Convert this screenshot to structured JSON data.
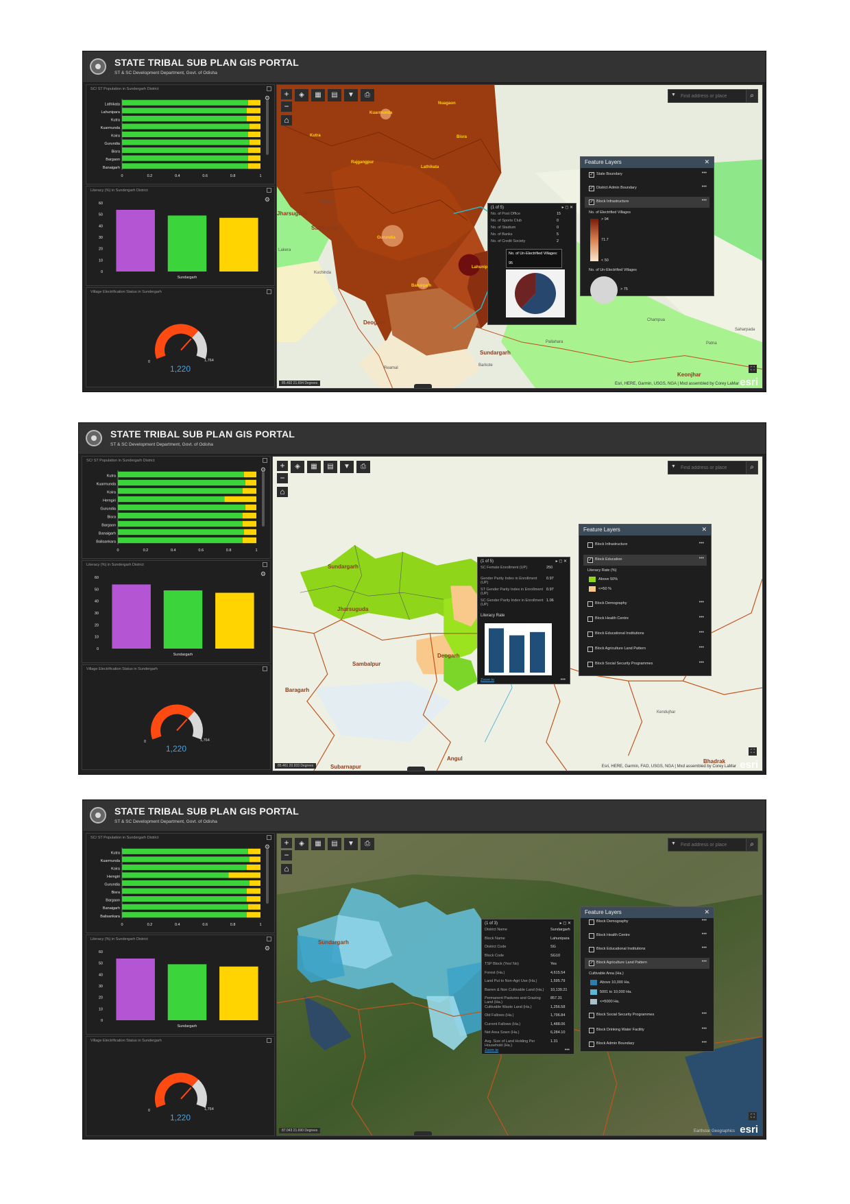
{
  "app": {
    "title": "STATE TRIBAL SUB PLAN GIS PORTAL",
    "subtitle": "ST & SC Development Department, Govt. of Odisha"
  },
  "panel_titles": {
    "population": "SC/ ST Population in Sundergarh District",
    "literacy": "Literacy (%) in Sundergarh District",
    "electrification": "Village Electrification Status in Sundergarh"
  },
  "search_placeholder": "Find address or place",
  "feature_layers_title": "Feature Layers",
  "gauge": {
    "min_label": "0",
    "max_label": "1,764",
    "value_label": "1,220",
    "value": 1220,
    "max": 1764
  },
  "colors": {
    "green": "#3bd43b",
    "yellow": "#ffd400",
    "purple": "#b455d4",
    "gauge": "#ff4a12",
    "map_brown": "#9b3b10"
  },
  "screens": [
    {
      "population": {
        "categories": [
          "Lathikata",
          "Lahunipara",
          "Kutra",
          "Kuarmunda",
          "Koira",
          "Gurundia",
          "Bisra",
          "Bargaon",
          "Banaigarh"
        ],
        "st_share": [
          0.91,
          0.9,
          0.9,
          0.92,
          0.91,
          0.92,
          0.91,
          0.91,
          0.91
        ]
      },
      "coord": "85.492 21.694 Degrees",
      "attribution": "Esri, HERE, Garmin, USGS, NGA | Mxd assembled by Corey LaMar",
      "map_labels": [
        "Kuarmunda",
        "Nuagaon",
        "Kutra",
        "Bisra",
        "Rajgangpur",
        "Lathikata",
        "Gurundia",
        "Banaigarh",
        "Lahunipara",
        "Jharsuguda",
        "Sambalpur",
        "Deogarh",
        "Sundargarh",
        "Keonjhar",
        "Bamra",
        "Kuchinda",
        "Pallahara",
        "Reamal",
        "Barkote",
        "Champua",
        "Saharpada",
        "Patna",
        "Lakera"
      ],
      "layers": [
        {
          "label": "State Boundary",
          "checked": true,
          "selected": false
        },
        {
          "label": "District Admin Boundary",
          "checked": true,
          "selected": false
        },
        {
          "label": "Block Infrastructure",
          "checked": true,
          "selected": true
        }
      ],
      "legend": {
        "electrified_title": "No. of Electrified Villages",
        "high": "> 94",
        "mid": "71.7",
        "low": "< 50",
        "unelectrified_title": "No. of Un-Electrified Villages",
        "bubble": "> 75"
      },
      "popup": {
        "header": "(1 of 5)",
        "rows": [
          {
            "k": "No. of Post Office",
            "v": "15"
          },
          {
            "k": "No. of Sports Club",
            "v": "0"
          },
          {
            "k": "No. of Stadium",
            "v": "0"
          },
          {
            "k": "No. of Banks",
            "v": "5"
          },
          {
            "k": "No. of Credit Society",
            "v": "2"
          }
        ],
        "tooltip_title": "No. of Un-Electrified Villages:",
        "tooltip_value": "95",
        "pie_share": 0.62
      }
    },
    {
      "population": {
        "categories": [
          "Kutra",
          "Kuarmunda",
          "Koira",
          "Hemgiri",
          "Gurundia",
          "Bisra",
          "Bargaon",
          "Banaigarh",
          "Balisankara"
        ],
        "st_share": [
          0.91,
          0.92,
          0.9,
          0.77,
          0.92,
          0.9,
          0.9,
          0.91,
          0.9
        ]
      },
      "coord": "85.461 20.933 Degrees",
      "attribution": "Esri, HERE, Garmin, FAO, USGS, NGA | Mxd assembled by Corey LaMar",
      "map_labels": [
        "Sundargarh",
        "Jharsuguda",
        "Sambalpur",
        "Deogarh",
        "Baragarh",
        "Subarnapur",
        "Angul",
        "Bhadrak",
        "Kendujhar"
      ],
      "layers": [
        {
          "label": "Block Infrastructure",
          "checked": false,
          "selected": false
        },
        {
          "label": "Block Education",
          "checked": true,
          "selected": true
        },
        {
          "label": "Block Demography",
          "checked": false,
          "selected": false
        },
        {
          "label": "Block Health Centre",
          "checked": false,
          "selected": false
        },
        {
          "label": "Block Educational Institutions",
          "checked": false,
          "selected": false
        },
        {
          "label": "Block Agriculture Land Pattern",
          "checked": false,
          "selected": false
        },
        {
          "label": "Block Social Security Programmes",
          "checked": false,
          "selected": false
        }
      ],
      "legend": {
        "title": "Literacy Rate (%)",
        "above": "Above 50%",
        "below": "<=50 %"
      },
      "popup": {
        "header": "(1 of 5)",
        "rows": [
          {
            "k": "SC Female Enrollment (UP)",
            "v": "250"
          },
          {
            "k": "Gender Parity Index in Enrollment (UP)",
            "v": "0.97"
          },
          {
            "k": "ST Gender Parity Index in Enrollment (UP)",
            "v": "0.97"
          },
          {
            "k": "SC Gender Parity Index in Enrollment (UP)",
            "v": "1.06"
          }
        ],
        "chart_title": "Literacy Rate",
        "bars": [
          0.95,
          0.8,
          0.87
        ],
        "zoom": "Zoom to"
      }
    },
    {
      "population": {
        "categories": [
          "Kutra",
          "Kuarmunda",
          "Koira",
          "Hemgiri",
          "Gurundia",
          "Bisra",
          "Bargaon",
          "Banaigarh",
          "Balisankara"
        ],
        "st_share": [
          0.91,
          0.92,
          0.9,
          0.77,
          0.92,
          0.9,
          0.9,
          0.91,
          0.9
        ]
      },
      "coord": "87.043 21.690 Degrees",
      "attribution": "Earthstar Geographics",
      "map_labels": [
        "Sundargarh"
      ],
      "layers": [
        {
          "label": "Block Demography",
          "checked": false,
          "selected": false
        },
        {
          "label": "Block Health Centre",
          "checked": false,
          "selected": false
        },
        {
          "label": "Block Educational Institutions",
          "checked": false,
          "selected": false
        },
        {
          "label": "Block Agriculture Land Pattern",
          "checked": true,
          "selected": true
        },
        {
          "label": "Block Social Security Programmes",
          "checked": false,
          "selected": false
        },
        {
          "label": "Block Drinking Water Facility",
          "checked": false,
          "selected": false
        },
        {
          "label": "Block Admin Boundary",
          "checked": false,
          "selected": false
        }
      ],
      "legend": {
        "title": "Cultivable Area (Ha.)",
        "a": "Above 10,000 Ha.",
        "b": "5001 to 10,000 Ha.",
        "c": "<=5000 Ha."
      },
      "popup": {
        "header": "(1 of 3)",
        "rows": [
          {
            "k": "District Name",
            "v": "Sundargarh"
          },
          {
            "k": "Block Name",
            "v": "Lahunipara"
          },
          {
            "k": "District Code",
            "v": "SG"
          },
          {
            "k": "Block Code",
            "v": "SG10"
          },
          {
            "k": "TSP Block (Yes/ No)",
            "v": "Yes"
          },
          {
            "k": "Forest (Ha.)",
            "v": "4,615.54"
          },
          {
            "k": "Land Put to Non-Agri Use (Ha.)",
            "v": "1,595.79"
          },
          {
            "k": "Barren & Non Cultivable Land (Ha.)",
            "v": "10,139.21"
          },
          {
            "k": "Permanent Pastures and Grazing Land (Ha.)",
            "v": "857.31"
          },
          {
            "k": "Cultivable Waste Land (Ha.)",
            "v": "1,256.58"
          },
          {
            "k": "Old Fallows (Ha.)",
            "v": "1,796.84"
          },
          {
            "k": "Current Fallows (Ha.)",
            "v": "1,488.06"
          },
          {
            "k": "Net Area Sown (Ha.)",
            "v": "6,284.10"
          },
          {
            "k": "Avg. Size of Land Holding Per Household (Ha.)",
            "v": "1.31"
          }
        ],
        "zoom": "Zoom to"
      }
    }
  ],
  "chart_data": [
    {
      "type": "bar",
      "orientation": "horizontal",
      "stacked": true,
      "title": "SC/ ST Population in Sundergarh District",
      "categories": [
        "Lathikata",
        "Lahunipara",
        "Kutra",
        "Kuarmunda",
        "Koira",
        "Gurundia",
        "Bisra",
        "Bargaon",
        "Banaigarh"
      ],
      "xlim": [
        0,
        1
      ],
      "xticks": [
        "0",
        "0.2",
        "0.4",
        "0.6",
        "0.8",
        "1"
      ],
      "series": [
        {
          "values": [
            0.91,
            0.9,
            0.9,
            0.92,
            0.91,
            0.92,
            0.91,
            0.91,
            0.91
          ]
        },
        {
          "values": [
            0.09,
            0.1,
            0.1,
            0.08,
            0.09,
            0.08,
            0.09,
            0.09,
            0.09
          ]
        }
      ]
    },
    {
      "type": "bar",
      "title": "Literacy (%) in Sundergarh District",
      "categories": [
        "Sundargarh"
      ],
      "ylim": [
        0,
        60
      ],
      "yticks": [
        "0",
        "10",
        "20",
        "30",
        "40",
        "50",
        "60"
      ],
      "values": [
        54,
        49,
        47
      ]
    },
    {
      "type": "gauge",
      "title": "Village Electrification Status in Sundergarh",
      "min": 0,
      "max": 1764,
      "value": 1220
    }
  ]
}
